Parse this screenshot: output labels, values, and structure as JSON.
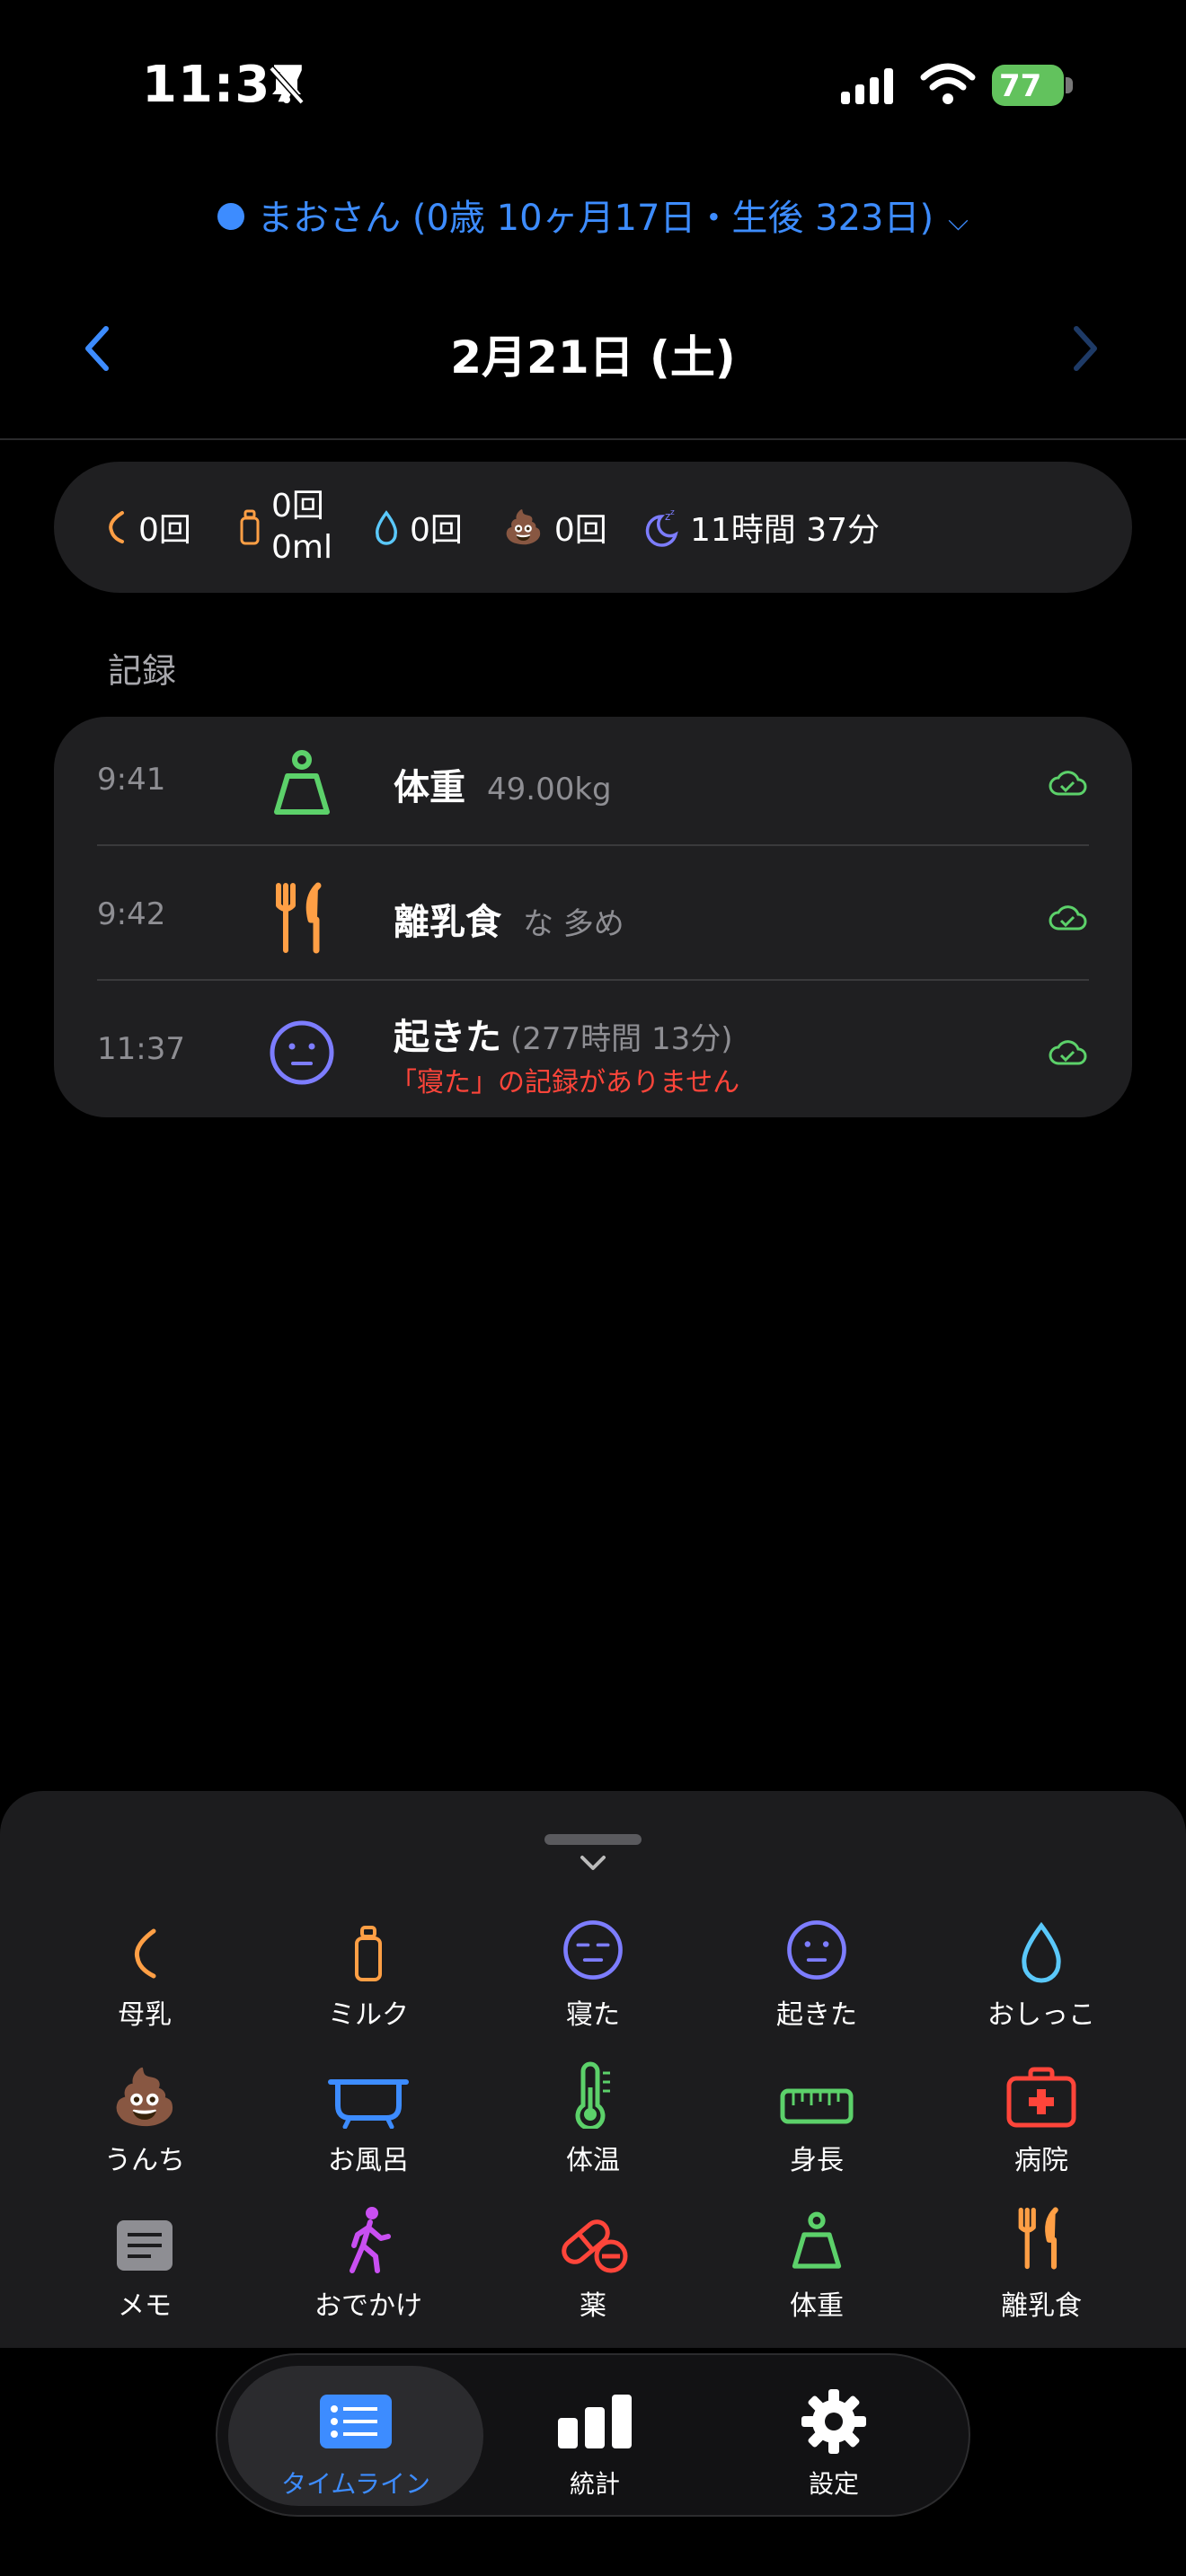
{
  "status_bar": {
    "time": "11:37",
    "battery": "77"
  },
  "profile": {
    "label": "まおさん (0歳 10ヶ月17日・生後 323日)"
  },
  "date_nav": {
    "title": "2月21日 (土)"
  },
  "summary": {
    "breast": "0回",
    "milk_count": "0回",
    "milk_volume": "0ml",
    "pee": "0回",
    "poop": "0回",
    "sleep": "11時間 37分"
  },
  "section": {
    "label": "記録"
  },
  "records": [
    {
      "time": "9:41",
      "icon": "weight-scale-icon",
      "title": "体重",
      "detail": "49.00kg"
    },
    {
      "time": "9:42",
      "icon": "fork-knife-icon",
      "title": "離乳食",
      "detail": "な 多め"
    },
    {
      "time": "11:37",
      "icon": "awake-face-icon",
      "title": "起きた",
      "detail": "(277時間 13分)",
      "warning": "「寝た」の記録がありません"
    }
  ],
  "quick_actions": [
    {
      "label": "母乳",
      "icon": "breast-icon"
    },
    {
      "label": "ミルク",
      "icon": "bottle-icon"
    },
    {
      "label": "寝た",
      "icon": "sleep-face-icon"
    },
    {
      "label": "起きた",
      "icon": "awake-face-icon"
    },
    {
      "label": "おしっこ",
      "icon": "drop-icon"
    },
    {
      "label": "うんち",
      "icon": "poop-icon"
    },
    {
      "label": "お風呂",
      "icon": "bathtub-icon"
    },
    {
      "label": "体温",
      "icon": "thermometer-icon"
    },
    {
      "label": "身長",
      "icon": "ruler-icon"
    },
    {
      "label": "病院",
      "icon": "medkit-icon"
    },
    {
      "label": "メモ",
      "icon": "memo-icon"
    },
    {
      "label": "おでかけ",
      "icon": "walking-icon"
    },
    {
      "label": "薬",
      "icon": "pill-icon"
    },
    {
      "label": "体重",
      "icon": "weight-scale-icon"
    },
    {
      "label": "離乳食",
      "icon": "fork-knife-icon"
    }
  ],
  "tabs": [
    {
      "label": "タイムライン",
      "icon": "timeline-icon",
      "active": true
    },
    {
      "label": "統計",
      "icon": "stats-icon",
      "active": false
    },
    {
      "label": "設定",
      "icon": "gear-icon",
      "active": false
    }
  ],
  "colors": {
    "accent": "#3d8cff",
    "orange": "#ff9f45",
    "green": "#5cd16a",
    "purple": "#7d7dff",
    "red": "#ff453a",
    "cyan": "#5ac8fa"
  }
}
